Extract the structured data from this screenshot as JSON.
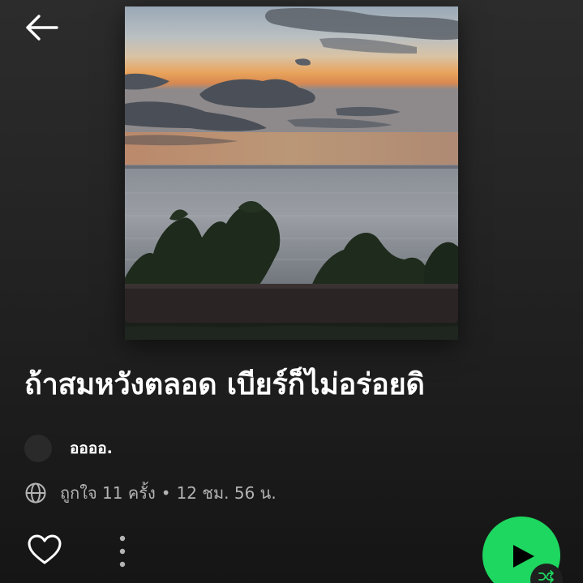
{
  "playlist": {
    "title": "ถ้าสมหวังตลอด เบียร์ก็ไม่อร่อยดิ",
    "owner": "ออออ.",
    "likes": "ถูกใจ 11 ครั้ง",
    "separator": "•",
    "duration": "12 ชม. 56 น."
  },
  "icons": {
    "back": "arrow-left-icon",
    "visibility": "globe-icon",
    "like": "heart-outline-icon",
    "more": "more-vertical-icon",
    "play": "play-icon",
    "shuffle": "shuffle-icon"
  },
  "colors": {
    "accent": "#1ed760",
    "background_top": "#2c2c2c",
    "background_bottom": "#151515",
    "secondary_text": "#b3b3b3",
    "primary_text": "#ffffff"
  }
}
